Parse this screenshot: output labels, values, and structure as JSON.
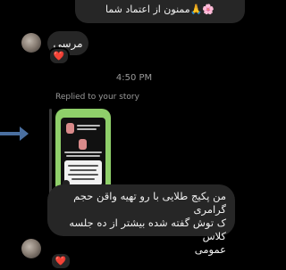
{
  "top_message": {
    "text": "ممنون از اعتماد شما",
    "emoji": "🌸🙏"
  },
  "first_message": {
    "text": "مرسی",
    "reaction": "❤️"
  },
  "timestamp": "4:50 PM",
  "reply_label": "Replied to your story",
  "main_message": {
    "line1": "من پکیج طلایی با رو تهیه واقن حجم گرامری",
    "line2": "ک توش گفته شده بیشتر از ده جلسه کلاس",
    "line3": "عمومی",
    "reaction": "❤️"
  }
}
